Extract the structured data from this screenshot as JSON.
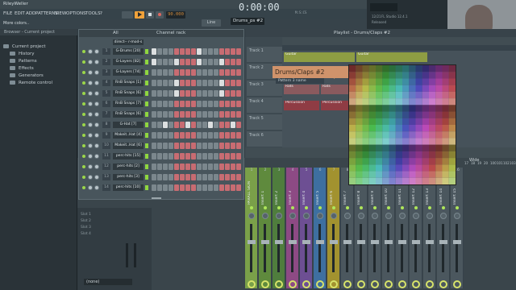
{
  "title_bar": {
    "user": "RileyWeller"
  },
  "menu": [
    "FILE",
    "EDIT",
    "ADD",
    "PATTERNS",
    "VIEW",
    "OPTIONS",
    "TOOLS",
    "?"
  ],
  "hint": "More colors..",
  "transport": {
    "time": "0:00:00",
    "time_sub": "M:S:CS",
    "tempo": "90.000",
    "pattern": "Drums_ps #2",
    "snap": "Line"
  },
  "app_info": {
    "date": "12/21",
    "version": "FL Studio 12.4.1",
    "status": "Released"
  },
  "browser": {
    "header": "Browser - Current project",
    "items": [
      "Current project",
      "History",
      "Patterns",
      "Effects",
      "Generators",
      "Remote control"
    ]
  },
  "channel_rack": {
    "header_filter": "All",
    "title": "Channel rack",
    "instrument": "direct-- r-mod-s",
    "channels": [
      {
        "name": "G-Drums [20]",
        "num": "1"
      },
      {
        "name": "G-Layers [82]",
        "num": "2"
      },
      {
        "name": "G-Layers [74]",
        "num": "3"
      },
      {
        "name": "RnB Snaps [1]",
        "num": "4"
      },
      {
        "name": "RnB Snaps [6]",
        "num": "5"
      },
      {
        "name": "RnB Snaps [7]",
        "num": "6"
      },
      {
        "name": "RnB Snaps [6]",
        "num": "7"
      },
      {
        "name": "G-Hat [7]",
        "num": "8"
      },
      {
        "name": "Makeit..Hat [4]",
        "num": "9"
      },
      {
        "name": "Makeit..Hat [6]",
        "num": "10"
      },
      {
        "name": "perc-hits [15]",
        "num": "11"
      },
      {
        "name": "perc-hits [2]",
        "num": "12"
      },
      {
        "name": "perc-hits [3]",
        "num": "13"
      },
      {
        "name": "perc-hits [10]",
        "num": "14"
      }
    ]
  },
  "playlist": {
    "title": "Playlist - Drums/Claps #2",
    "tracks": [
      "Track 1",
      "Track 2",
      "Track 3",
      "Track 4",
      "Track 5",
      "Track 6"
    ],
    "clips": [
      "Guitar",
      "Guitar",
      "Rats",
      "Rats",
      "Percussion",
      "Percussion"
    ],
    "popup_name": "Drums/Claps #2",
    "popup_sub": "Pattern 3 name"
  },
  "mixer": {
    "strips": [
      "PARALL SION",
      "Insert 1",
      "Insert 2",
      "Insert 3",
      "Insert 4",
      "Insert 5",
      "Insert 6",
      "Insert 7",
      "Insert 8",
      "Insert 9",
      "Insert 10",
      "Insert 11",
      "Insert 12",
      "Insert 13",
      "Insert 14",
      "Insert 15"
    ],
    "numbers": [
      "1",
      "2",
      "3",
      "4",
      "5",
      "6",
      "7",
      "8",
      "9",
      "10",
      "11",
      "12",
      "13",
      "14",
      "15",
      "16",
      "17",
      "18",
      "19",
      "20",
      "100",
      "101",
      "102",
      "103"
    ],
    "slots": [
      "Slot 1",
      "Slot 2",
      "Slot 3",
      "Slot 4"
    ],
    "bottom": "(none)",
    "wide_label": "Wide"
  },
  "colors": {
    "accent_orange": "#f0a23a",
    "led_green": "#9bd64a",
    "clip_guitar": "#8e9d43",
    "clip_perc": "#8f3c44"
  }
}
